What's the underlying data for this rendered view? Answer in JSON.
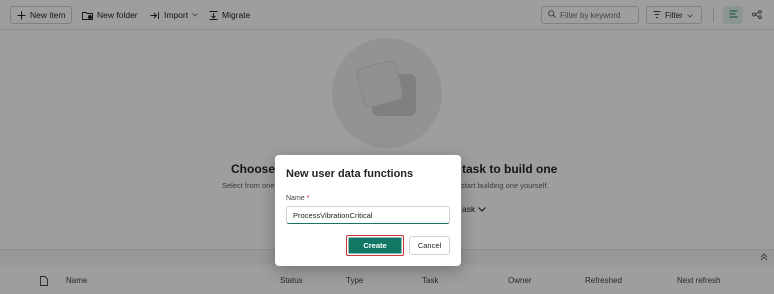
{
  "toolbar": {
    "new_item": "New item",
    "new_folder": "New folder",
    "import": "Import",
    "migrate": "Migrate",
    "search_placeholder": "Filter by keyword",
    "filter": "Filter"
  },
  "empty_state": {
    "title_left": "Choose f",
    "title_right": "task to build one",
    "sub_left": "Select from one",
    "sub_right": "start building one yourself.",
    "task_link": "ask"
  },
  "table": {
    "columns": [
      "Name",
      "Status",
      "Type",
      "Task",
      "Owner",
      "Refreshed",
      "Next refresh"
    ]
  },
  "dialog": {
    "title": "New user data functions",
    "name_label": "Name",
    "required_mark": "*",
    "name_value": "ProcessVibrationCritical",
    "create": "Create",
    "cancel": "Cancel"
  },
  "colors": {
    "accent": "#117865",
    "highlight_border": "#d13438"
  },
  "icons": [
    "plus-icon",
    "new-folder-icon",
    "import-icon",
    "migrate-icon",
    "search-icon",
    "filter-icon",
    "list-view-icon",
    "lineage-view-icon",
    "chevron-down-icon",
    "collapse-up-icon",
    "file-type-icon"
  ]
}
